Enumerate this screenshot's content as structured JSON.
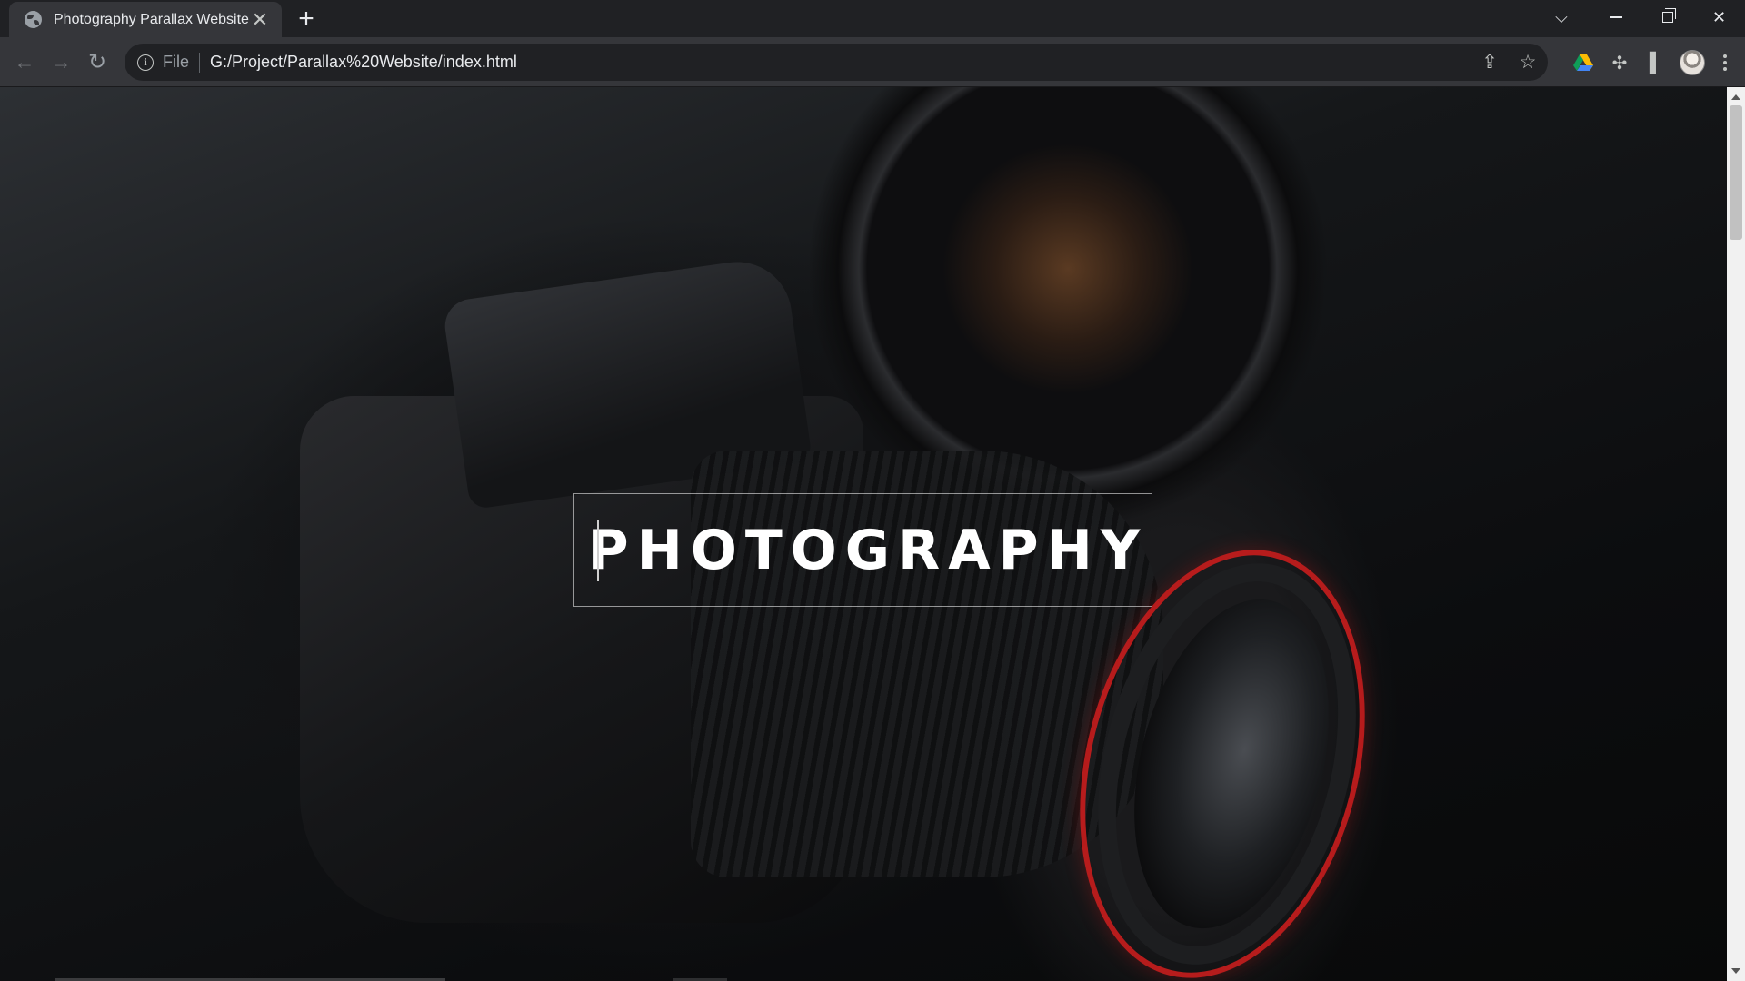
{
  "browser": {
    "tab": {
      "title": "Photography Parallax Website",
      "favicon": "globe-icon",
      "close_glyph": "✕"
    },
    "new_tab_glyph": "+",
    "window_controls": {
      "tab_search": "chevron-down-icon",
      "minimize": "minimize-icon",
      "restore": "restore-icon",
      "close": "close-icon",
      "close_glyph": "✕",
      "chevron_glyph": "⌵"
    },
    "nav": {
      "back": "back-arrow-icon",
      "forward": "forward-arrow-icon",
      "reload": "reload-icon",
      "back_glyph": "←",
      "forward_glyph": "→",
      "reload_glyph": "↻"
    },
    "address_bar": {
      "scheme_label": "File",
      "info_glyph": "i",
      "url": "G:/Project/Parallax%20Website/index.html",
      "share_glyph": "⇪",
      "bookmark_glyph": "☆"
    },
    "extensions": [
      "google-drive-icon",
      "puzzle-icon",
      "side-panel-icon",
      "profile-avatar",
      "menu-icon"
    ],
    "puzzle_glyph": "✣",
    "sidepanel_glyph": "▌"
  },
  "page": {
    "hero_title": "PHOTOGRAPHY",
    "background": "camera-photo"
  },
  "colors": {
    "chrome_dark": "#202124",
    "toolbar": "#35363a",
    "accent_red": "#c81d1d",
    "title_text": "#ffffff"
  }
}
